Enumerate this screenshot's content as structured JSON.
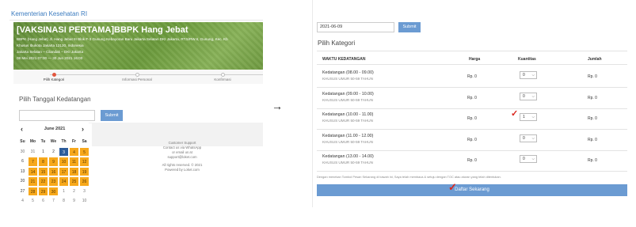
{
  "left": {
    "brand": "Kementerian Kesehatan RI",
    "banner": {
      "title": "[VAKSINASI PERTAMA]BBPK Hang Jebat",
      "address_1": "BBPK (Hang Jebat) Jl. Hang Jebat III Blok F-3 Gunung Kebayoran Baru Jakarta Selatan DKI Jakarta, RT.5/RW.6, Gunung, Kec. Kb",
      "address_2": "Khusus Ibukota Jakarta 12120, Indonesia",
      "region": "Jakarta Selatan – Cilandak – DKI Jakarta",
      "period": "08 Mei 2021 07:00 — 30 Jun 2021 16:00"
    },
    "steps": [
      "Pilih Kategori",
      "Informasi Personal",
      "Konfirmasi"
    ],
    "date_title": "Pilih Tanggal Kedatangan",
    "submit_label": "Submit",
    "calendar": {
      "month": "June 2021",
      "prev": "‹",
      "next": "›",
      "weekdays": [
        "Su",
        "Mo",
        "Tu",
        "We",
        "Th",
        "Fr",
        "Sa"
      ],
      "weeks": [
        [
          {
            "d": "30",
            "s": "muted"
          },
          {
            "d": "31",
            "s": "muted"
          },
          {
            "d": "1",
            "s": ""
          },
          {
            "d": "2",
            "s": ""
          },
          {
            "d": "3",
            "s": "sel"
          },
          {
            "d": "4",
            "s": "avail"
          },
          {
            "d": "5",
            "s": "avail"
          }
        ],
        [
          {
            "d": "6",
            "s": ""
          },
          {
            "d": "7",
            "s": "avail"
          },
          {
            "d": "8",
            "s": "avail"
          },
          {
            "d": "9",
            "s": "avail"
          },
          {
            "d": "10",
            "s": "avail"
          },
          {
            "d": "11",
            "s": "avail"
          },
          {
            "d": "12",
            "s": "avail"
          }
        ],
        [
          {
            "d": "13",
            "s": ""
          },
          {
            "d": "14",
            "s": "avail"
          },
          {
            "d": "15",
            "s": "avail"
          },
          {
            "d": "16",
            "s": "avail"
          },
          {
            "d": "17",
            "s": "avail"
          },
          {
            "d": "18",
            "s": "avail"
          },
          {
            "d": "19",
            "s": "avail"
          }
        ],
        [
          {
            "d": "20",
            "s": ""
          },
          {
            "d": "21",
            "s": "avail"
          },
          {
            "d": "22",
            "s": "avail"
          },
          {
            "d": "23",
            "s": "avail"
          },
          {
            "d": "24",
            "s": "avail"
          },
          {
            "d": "25",
            "s": "avail"
          },
          {
            "d": "26",
            "s": "avail"
          }
        ],
        [
          {
            "d": "27",
            "s": ""
          },
          {
            "d": "28",
            "s": "avail"
          },
          {
            "d": "29",
            "s": "avail"
          },
          {
            "d": "30",
            "s": "avail"
          },
          {
            "d": "1",
            "s": "muted"
          },
          {
            "d": "2",
            "s": "muted"
          },
          {
            "d": "3",
            "s": "muted"
          }
        ],
        [
          {
            "d": "4",
            "s": "muted"
          },
          {
            "d": "5",
            "s": "muted"
          },
          {
            "d": "6",
            "s": "muted"
          },
          {
            "d": "7",
            "s": "muted"
          },
          {
            "d": "8",
            "s": "muted"
          },
          {
            "d": "9",
            "s": "muted"
          },
          {
            "d": "10",
            "s": "muted"
          }
        ]
      ]
    },
    "footer": {
      "line1": "Customer Support",
      "line2": "Contact us via WhatsApp",
      "line3": "or email us at support@loket.com",
      "line4": "All rights reserved. © 2021",
      "line5": "Powered by Loket.com"
    }
  },
  "right": {
    "date_value": "2021-06-09",
    "submit_label": "Submit",
    "title": "Pilih Kategori",
    "headers": {
      "time": "WAKTU KEDATANGAN",
      "price": "Harga",
      "qty": "Kuantitas",
      "total": "Jumlah"
    },
    "rows": [
      {
        "slot": "Kedatangan (08.00 - 09.00)",
        "sub": "KHUSUS UMUR 50-59 TAHUN",
        "price": "Rp. 0",
        "qty": "0",
        "total": "Rp. 0"
      },
      {
        "slot": "Kedatangan (09.00 - 10.00)",
        "sub": "KHUSUS UMUR 50-59 TAHUN",
        "price": "Rp. 0",
        "qty": "0",
        "total": "Rp. 0"
      },
      {
        "slot": "Kedatangan (10.00 - 11.00)",
        "sub": "KHUSUS UMUR 50-59 TAHUN",
        "price": "Rp. 0",
        "qty": "1",
        "total": "Rp. 0"
      },
      {
        "slot": "Kedatangan (11.00 - 12.00)",
        "sub": "KHUSUS UMUR 50-59 TAHUN",
        "price": "Rp. 0",
        "qty": "0",
        "total": "Rp. 0"
      },
      {
        "slot": "Kedatangan (13.00 - 14.00)",
        "sub": "KHUSUS UMUR 50-59 TAHUN",
        "price": "Rp. 0",
        "qty": "0",
        "total": "Rp. 0"
      }
    ],
    "notice": "Dengan menekan Tombol Pesan Sekarang di bawah ini, Saya telah membaca & setuju dengan TOC atau aturan yang telah ditentukan.",
    "button_label": "Daftar Sekarang"
  },
  "colors": {
    "accent": "#6b9bd2",
    "available": "#f7a81b",
    "selected": "#2c5c9a",
    "check": "#d9251c"
  },
  "icons": {
    "arrow": "right-arrow-icon",
    "check": "checkmark-icon",
    "caret": "chevron-down-icon"
  }
}
